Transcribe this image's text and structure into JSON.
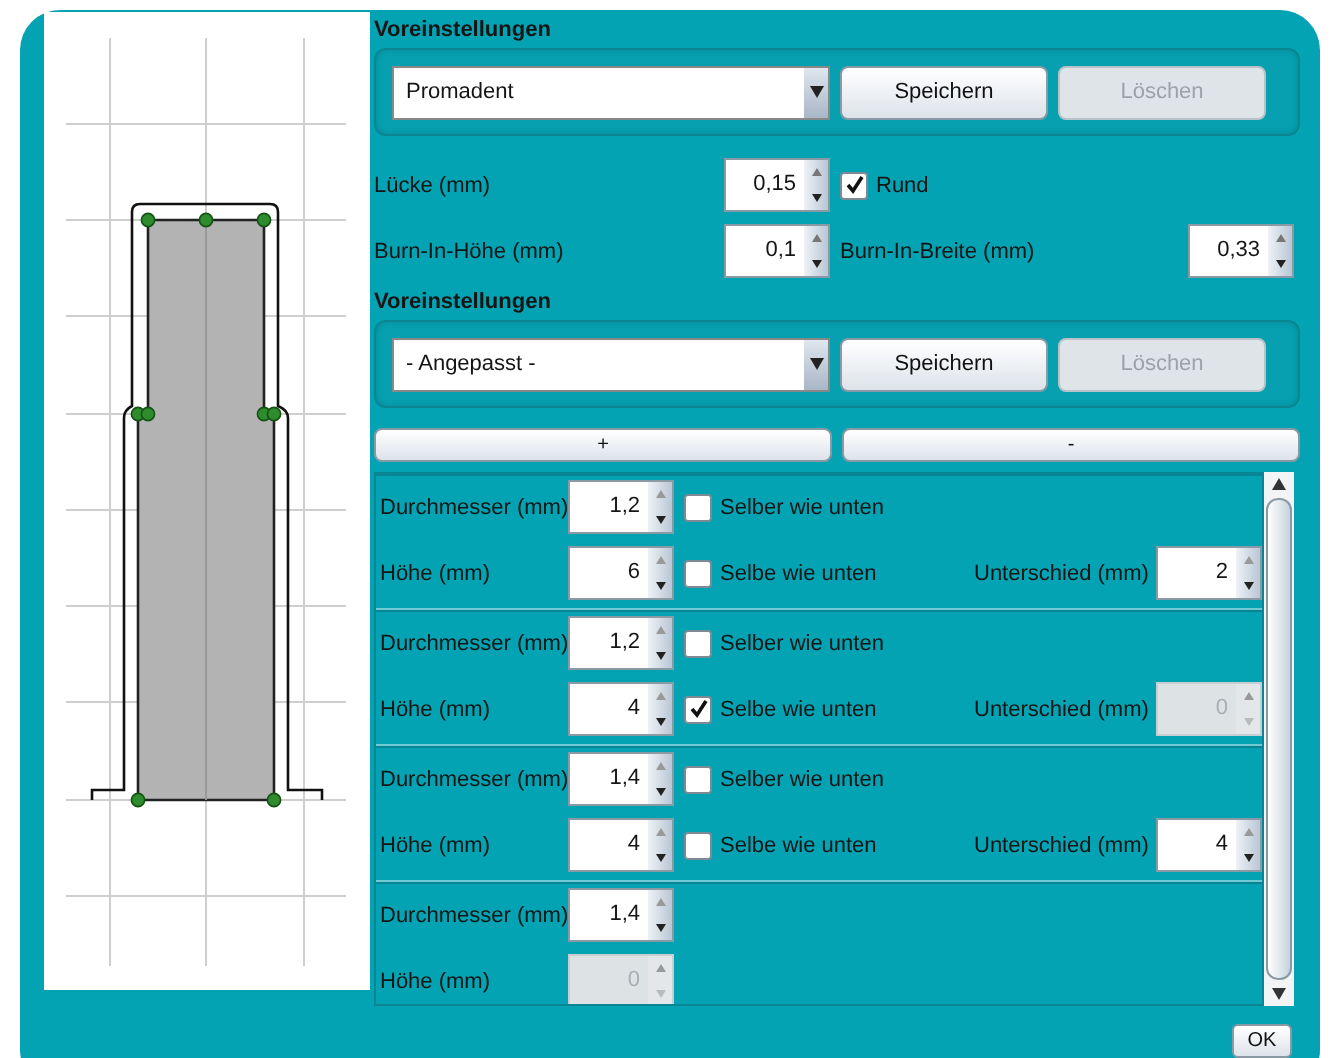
{
  "presets_top": {
    "title": "Voreinstellungen",
    "dropdown": "Promadent",
    "save": {
      "label": "Speichern",
      "disabled": false
    },
    "delete": {
      "label": "Löschen",
      "disabled": true
    }
  },
  "gap": {
    "label": "Lücke (mm)",
    "value": "0,15"
  },
  "round": {
    "label": "Rund",
    "checked": true
  },
  "burn_in_height": {
    "label": "Burn-In-Höhe (mm)",
    "value": "0,1"
  },
  "burn_in_width": {
    "label": "Burn-In-Breite (mm)",
    "value": "0,33"
  },
  "presets_segments": {
    "title": "Voreinstellungen",
    "dropdown": "- Angepasst -",
    "save": {
      "label": "Speichern",
      "disabled": false
    },
    "delete": {
      "label": "Löschen",
      "disabled": true
    }
  },
  "add_button": "+",
  "remove_button": "-",
  "segments": [
    {
      "diameter": {
        "label": "Durchmesser (mm)",
        "value": "1,2",
        "disabled": false
      },
      "diameter_same": {
        "label": "Selber wie unten",
        "checked": false
      },
      "height": {
        "label": "Höhe (mm)",
        "value": "6",
        "disabled": false
      },
      "height_same": {
        "label": "Selbe wie unten",
        "checked": false
      },
      "difference": {
        "label": "Unterschied (mm)",
        "value": "2",
        "disabled": false
      }
    },
    {
      "diameter": {
        "label": "Durchmesser (mm)",
        "value": "1,2",
        "disabled": false
      },
      "diameter_same": {
        "label": "Selber wie unten",
        "checked": false
      },
      "height": {
        "label": "Höhe (mm)",
        "value": "4",
        "disabled": false
      },
      "height_same": {
        "label": "Selbe wie unten",
        "checked": true
      },
      "difference": {
        "label": "Unterschied (mm)",
        "value": "0",
        "disabled": true
      }
    },
    {
      "diameter": {
        "label": "Durchmesser (mm)",
        "value": "1,4",
        "disabled": false
      },
      "diameter_same": {
        "label": "Selber wie unten",
        "checked": false
      },
      "height": {
        "label": "Höhe (mm)",
        "value": "4",
        "disabled": false
      },
      "height_same": {
        "label": "Selbe wie unten",
        "checked": false
      },
      "difference": {
        "label": "Unterschied (mm)",
        "value": "4",
        "disabled": false
      }
    },
    {
      "diameter": {
        "label": "Durchmesser (mm)",
        "value": "1,4",
        "disabled": false
      },
      "height": {
        "label": "Höhe (mm)",
        "value": "0",
        "disabled": true
      }
    }
  ],
  "ok_button": "OK"
}
